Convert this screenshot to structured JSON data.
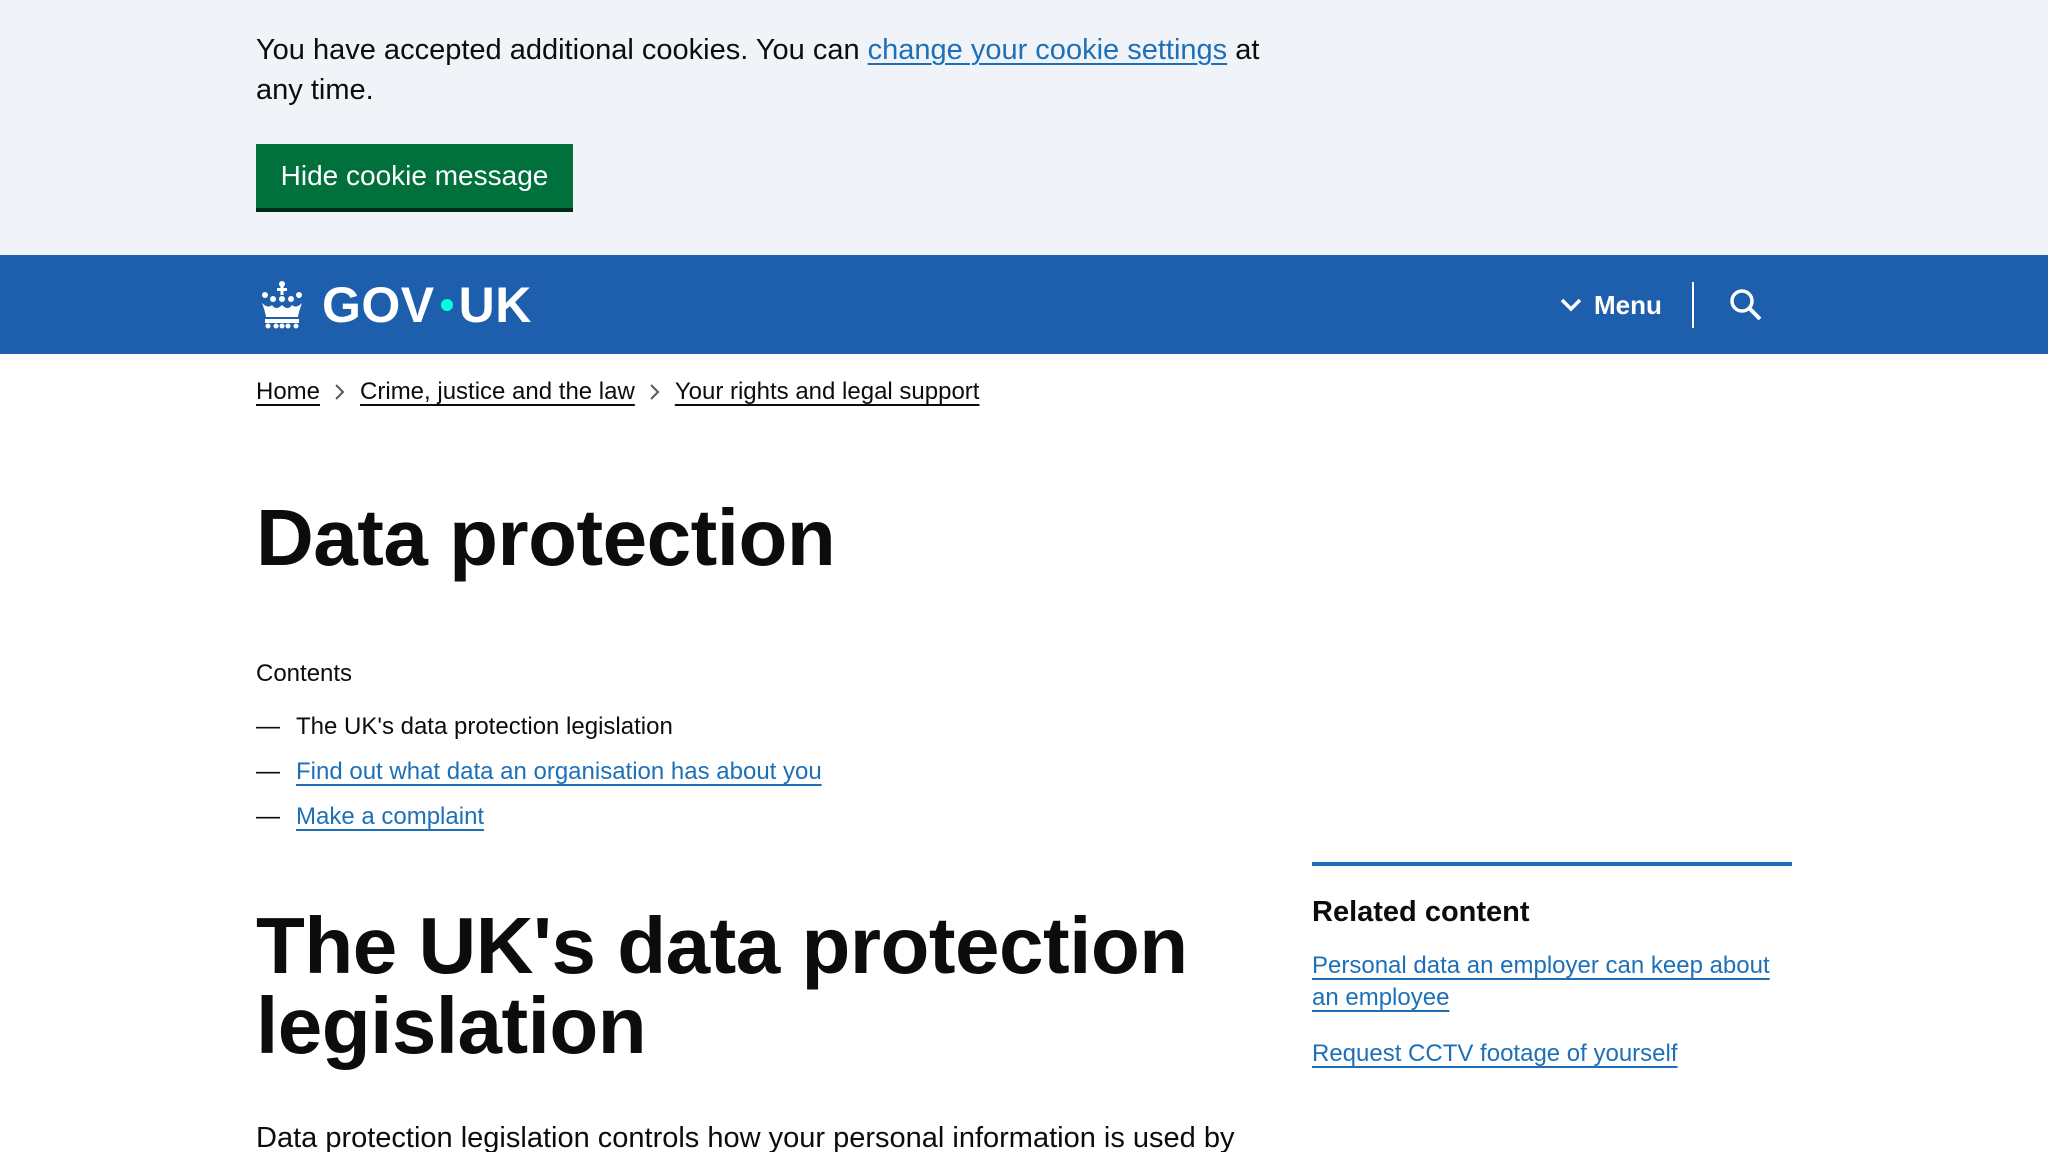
{
  "cookie_banner": {
    "text_before": "You have accepted additional cookies. You can ",
    "link_text": "change your cookie settings",
    "text_after": " at any time.",
    "hide_button": "Hide cookie message"
  },
  "header": {
    "logo_left": "GOV",
    "logo_right": "UK",
    "menu_label": "Menu",
    "icons": [
      "crown-icon",
      "chevron-down-icon",
      "search-icon"
    ]
  },
  "breadcrumbs": [
    {
      "label": "Home"
    },
    {
      "label": "Crime, justice and the law"
    },
    {
      "label": "Your rights and legal support"
    }
  ],
  "main": {
    "title": "Data protection",
    "contents_label": "Contents",
    "contents": [
      {
        "dash": "—",
        "label": "The UK's data protection legislation",
        "current": true
      },
      {
        "dash": "—",
        "label": "Find out what data an organisation has about you",
        "current": false
      },
      {
        "dash": "—",
        "label": "Make a complaint",
        "current": false
      }
    ],
    "section_heading": "The UK's data protection legislation",
    "body_start": "Data protection legislation controls how your personal information is used by"
  },
  "related": {
    "title": "Related content",
    "links": [
      {
        "label": "Personal data an employer can keep about an employee"
      },
      {
        "label": "Request CCTV footage of yourself"
      }
    ]
  },
  "colors": {
    "header_blue": "#1d5fac",
    "link_blue": "#1d70b8",
    "button_green": "#00703c",
    "banner_bg": "#f0f4f8",
    "logo_dot": "#00ffe0"
  }
}
